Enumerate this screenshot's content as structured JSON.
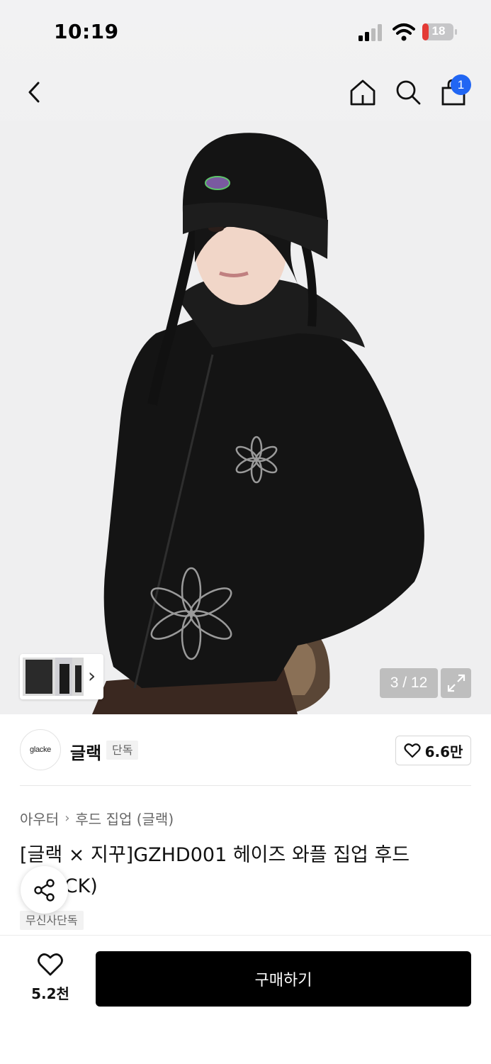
{
  "status_bar": {
    "time": "10:19",
    "battery": "18"
  },
  "nav": {
    "back_icon": "chevron-left-icon",
    "home_icon": "home-icon",
    "search_icon": "search-icon",
    "cart_icon": "shopping-bag-icon",
    "cart_badge": "1"
  },
  "gallery": {
    "counter": "3 / 12",
    "expand_icon": "expand-icon",
    "thumb_arrow": "›"
  },
  "brand": {
    "logo_text": "glacke",
    "name": "글랙",
    "tag": "단독",
    "likes": "6.6만"
  },
  "product": {
    "breadcrumb": [
      "아우터",
      "후드 집업 (글랙)"
    ],
    "title": "[글랙 × 지꾸]GZHD001 헤이즈 와플 집업 후드 (BLACK)",
    "tag": "무신사단독"
  },
  "bottom_bar": {
    "wish_count": "5.2천",
    "buy_label": "구매하기"
  },
  "colors": {
    "accent": "#2166f3",
    "buy_button": "#000000"
  }
}
